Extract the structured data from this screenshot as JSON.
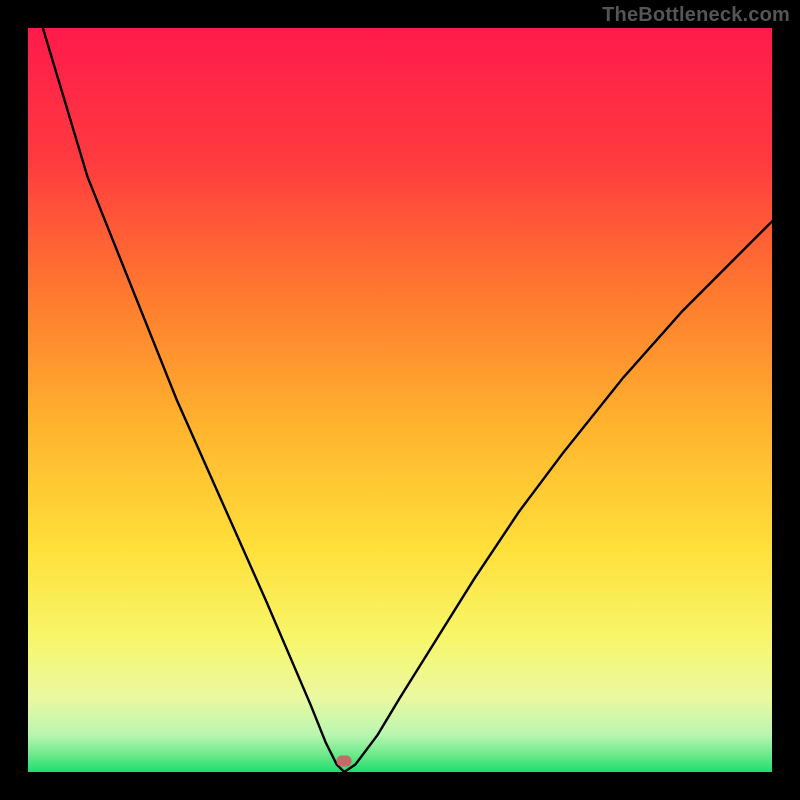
{
  "watermark": "TheBottleneck.com",
  "gradient": {
    "stops": [
      {
        "offset": "0%",
        "color": "#ff1a4b"
      },
      {
        "offset": "18%",
        "color": "#ff3b3f"
      },
      {
        "offset": "36%",
        "color": "#ff7a2f"
      },
      {
        "offset": "54%",
        "color": "#ffb52e"
      },
      {
        "offset": "70%",
        "color": "#ffe03a"
      },
      {
        "offset": "82%",
        "color": "#f7f66a"
      },
      {
        "offset": "90%",
        "color": "#eaf9a0"
      },
      {
        "offset": "95%",
        "color": "#b9f6b0"
      },
      {
        "offset": "98%",
        "color": "#63e887"
      },
      {
        "offset": "100%",
        "color": "#1adf6e"
      }
    ]
  },
  "curve": {
    "stroke": "#000000",
    "width": 2.4
  },
  "marker": {
    "x_pct": 42.5,
    "y_pct": 98.5,
    "color": "#c56a66"
  },
  "chart_data": {
    "type": "line",
    "title": "",
    "xlabel": "",
    "ylabel": "",
    "xlim": [
      0,
      100
    ],
    "ylim": [
      0,
      100
    ],
    "description": "Bottleneck curve: V-shaped line on red→green vertical gradient. Left arm descends steeply from top-left; minimum (optimal point, marked) near x≈42.5, y≈0; right arm rises more gently toward upper-right.",
    "series": [
      {
        "name": "bottleneck-curve",
        "x": [
          0,
          2,
          5,
          8,
          12,
          16,
          20,
          24,
          28,
          32,
          35,
          38,
          40,
          41.5,
          42.5,
          44,
          47,
          50,
          55,
          60,
          66,
          72,
          80,
          88,
          96,
          100
        ],
        "y": [
          108,
          100,
          90,
          80,
          70,
          60,
          50,
          41,
          32,
          23,
          16,
          9,
          4,
          1,
          0,
          1,
          5,
          10,
          18,
          26,
          35,
          43,
          53,
          62,
          70,
          74
        ]
      }
    ],
    "marker_point": {
      "x": 42.5,
      "y": 0
    }
  }
}
